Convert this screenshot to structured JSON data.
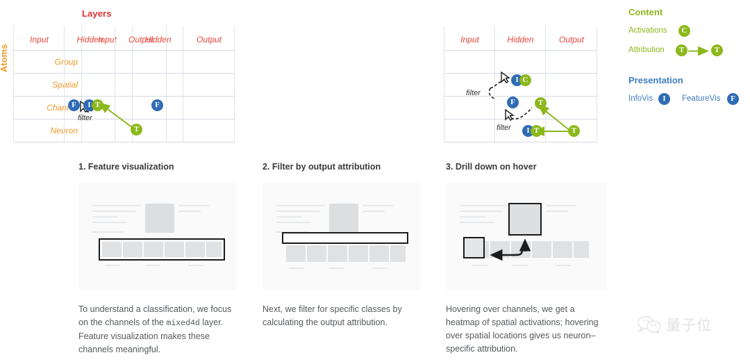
{
  "figure": {
    "axis_titles": {
      "columns": "Layers",
      "rows": "Atoms"
    },
    "column_headers": [
      "Input",
      "Hidden",
      "Output"
    ],
    "row_headers": [
      "Group",
      "Spatial",
      "Channel",
      "Neuron"
    ],
    "filter_label": "filter"
  },
  "matrices": [
    {
      "name": "matrix-1",
      "tokens": [
        {
          "label": "F",
          "kind": "blue",
          "row": "Channel",
          "column": "Hidden"
        }
      ],
      "filter_labels": [],
      "arrows": []
    },
    {
      "name": "matrix-2",
      "tokens": [
        {
          "label": "F",
          "kind": "blue",
          "row": "Channel",
          "column": "Hidden"
        },
        {
          "label": "I",
          "kind": "blue",
          "row": "Channel",
          "column": "Hidden"
        },
        {
          "label": "T",
          "kind": "green",
          "row": "Channel",
          "column": "Hidden"
        },
        {
          "label": "T",
          "kind": "green",
          "row": "Neuron",
          "column": "Output"
        }
      ],
      "filter_labels": [
        "filter"
      ],
      "arrows": [
        {
          "kind": "attribution-solid",
          "from": "Output/Neuron T",
          "to": "Hidden/Channel T"
        },
        {
          "kind": "cursor-dashed",
          "from": "cursor",
          "to": "Hidden/Channel T"
        }
      ]
    },
    {
      "name": "matrix-3",
      "tokens": [
        {
          "label": "I",
          "kind": "blue",
          "row": "Spatial",
          "column": "Hidden"
        },
        {
          "label": "C",
          "kind": "green",
          "row": "Spatial",
          "column": "Hidden"
        },
        {
          "label": "F",
          "kind": "blue",
          "row": "Channel",
          "column": "Hidden"
        },
        {
          "label": "T",
          "kind": "green",
          "row": "Channel",
          "column": "Hidden-Output"
        },
        {
          "label": "I",
          "kind": "blue",
          "row": "Neuron",
          "column": "Hidden-Output"
        },
        {
          "label": "T",
          "kind": "green",
          "row": "Neuron",
          "column": "Hidden-Output"
        },
        {
          "label": "T",
          "kind": "green",
          "row": "Neuron",
          "column": "Output"
        }
      ],
      "filter_labels": [
        "filter",
        "filter"
      ],
      "arrows": [
        {
          "kind": "cursor-dashed",
          "from": "cursor",
          "to": "Spatial/Hidden I"
        },
        {
          "kind": "cursor-dashed",
          "from": "cursor",
          "to": "Channel T"
        },
        {
          "kind": "attribution-solid",
          "from": "Output T",
          "to": "Channel T"
        },
        {
          "kind": "attribution-solid",
          "from": "Output T",
          "to": "Neuron T"
        }
      ]
    }
  ],
  "legend": {
    "content": {
      "title": "Content",
      "items": [
        {
          "label": "Activations",
          "token": "C",
          "kind": "green"
        },
        {
          "label": "Attribution",
          "token": "T",
          "kind": "green",
          "second_token": "T",
          "arrow": true
        }
      ]
    },
    "presentation": {
      "title": "Presentation",
      "items": [
        {
          "label": "InfoVis",
          "token": "I",
          "kind": "blue"
        },
        {
          "label": "FeatureVis",
          "token": "F",
          "kind": "blue"
        }
      ]
    }
  },
  "steps": [
    {
      "heading": "1. Feature visualization",
      "body_pre": "To understand a classification, we focus on the channels of the ",
      "body_code": "mixed4d",
      "body_post": " layer. Feature visualization makes these channels meaningful."
    },
    {
      "heading": "2. Filter by output attribution",
      "body_pre": "Next, we filter for specific classes by calculating the output attribution.",
      "body_code": "",
      "body_post": ""
    },
    {
      "heading": "3. Drill down on hover",
      "body_pre": "Hovering over channels, we get a heatmap of spatial activations; hovering over spatial locations gives us neuron–specific attribution.",
      "body_code": "",
      "body_post": ""
    }
  ],
  "watermark": {
    "text": "量子位"
  },
  "colors": {
    "layers_title": "#e03030",
    "atoms_title": "#f0992a",
    "column_header": "#e8453c",
    "row_header": "#f0992a",
    "content_green": "#8cb81c",
    "presentation_blue": "#2f6db4",
    "grid_line": "#dfe4ea",
    "body_text": "#55595d"
  }
}
